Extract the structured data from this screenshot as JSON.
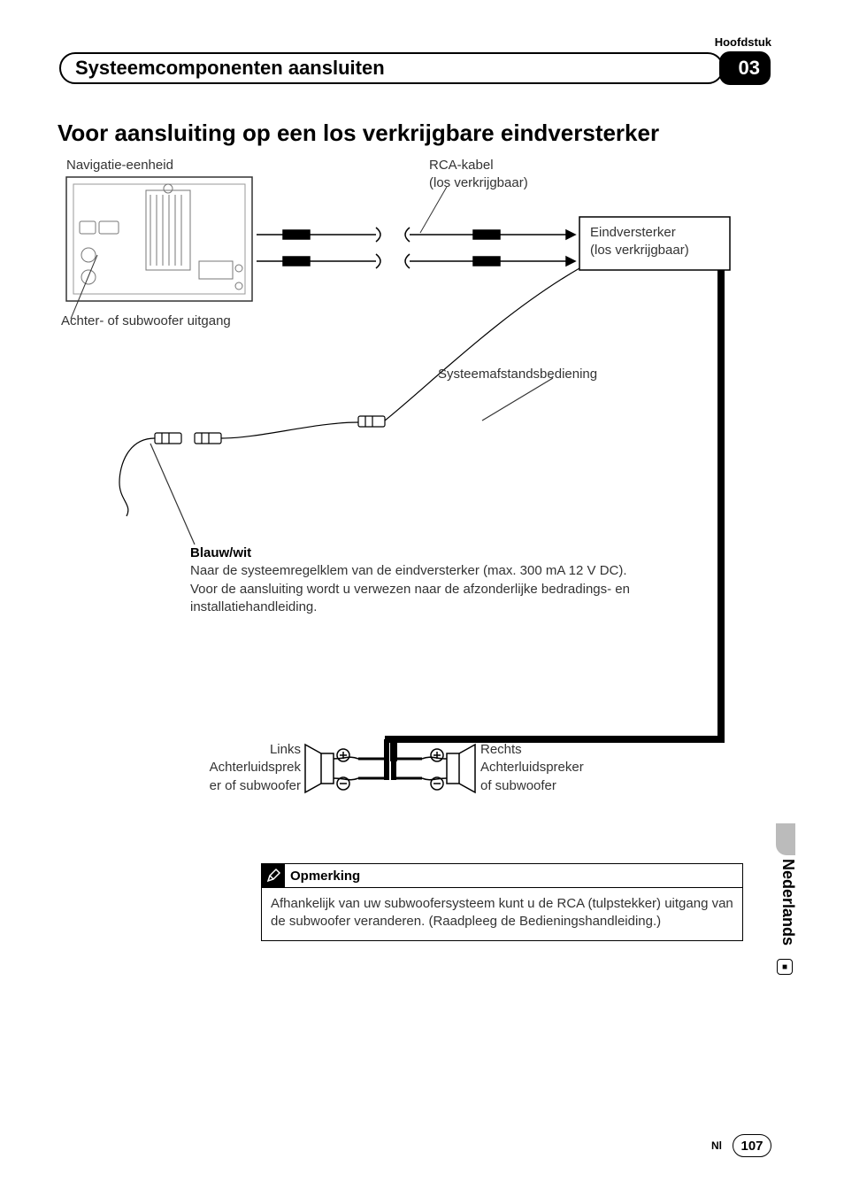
{
  "header": {
    "chapter_label": "Hoofdstuk",
    "section_title": "Systeemcomponenten aansluiten",
    "chapter_number": "03"
  },
  "heading": "Voor aansluiting op een los verkrijgbare eindversterker",
  "diagram": {
    "nav_unit": "Navigatie-eenheid",
    "rca_cable": "RCA-kabel",
    "rca_cable_sub": "(los verkrijgbaar)",
    "amplifier": "Eindversterker",
    "amplifier_sub": "(los verkrijgbaar)",
    "rear_sub_output": "Achter- of subwoofer uitgang",
    "system_remote": "Systeemafstandsbediening",
    "blue_white_title": "Blauw/wit",
    "blue_white_body": "Naar de systeemregelklem van de eindversterker (max. 300 mA 12 V DC). Voor de aansluiting wordt u verwezen naar de afzonderlijke bedradings- en installatiehandleiding.",
    "left_title": "Links",
    "left_body": "Achterluidsprek​er of subwoofer",
    "right_title": "Rechts",
    "right_body": "Achterluidsprek​er of subwoofer"
  },
  "note": {
    "title": "Opmerking",
    "body": "Afhankelijk van uw subwoofersysteem kunt u de RCA (tulpstekker) uitgang van de subwoofer veranderen. (Raadpleeg de Bedieningshandleiding.)"
  },
  "side": {
    "language": "Nederlands"
  },
  "footer": {
    "lang_code": "Nl",
    "page": "107"
  }
}
